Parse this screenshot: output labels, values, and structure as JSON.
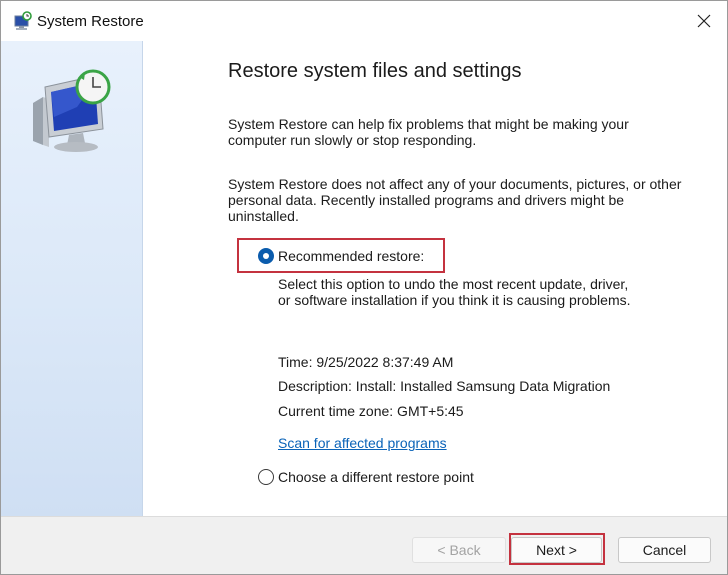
{
  "window": {
    "title": "System Restore",
    "title_icon": "system-restore-icon",
    "close_icon": "close-icon"
  },
  "sidebar": {
    "icon": "system-restore-monitor-icon"
  },
  "main": {
    "heading": "Restore system files and settings",
    "paragraph1": "System Restore can help fix problems that might be making your\ncomputer run slowly or stop responding.",
    "paragraph2": "System Restore does not affect any of your documents, pictures, or other\npersonal data. Recently installed programs and drivers might be\nuninstalled.",
    "recommended": {
      "label": "Recommended restore:",
      "selected": true,
      "description": "Select this option to undo the most recent update, driver,\nor software installation if you think it is causing problems.",
      "time": "Time: 9/25/2022 8:37:49 AM",
      "restore_description": "Description: Install: Installed Samsung Data Migration",
      "timezone": "Current time zone: GMT+5:45",
      "scan_link": "Scan for affected programs"
    },
    "different": {
      "label": "Choose a different restore point",
      "selected": false
    }
  },
  "footer": {
    "back_label": "< Back",
    "next_label": "Next >",
    "cancel_label": "Cancel"
  },
  "colors": {
    "highlight": "#c4323f",
    "accent": "#0b5cad",
    "link": "#0a63b8"
  }
}
